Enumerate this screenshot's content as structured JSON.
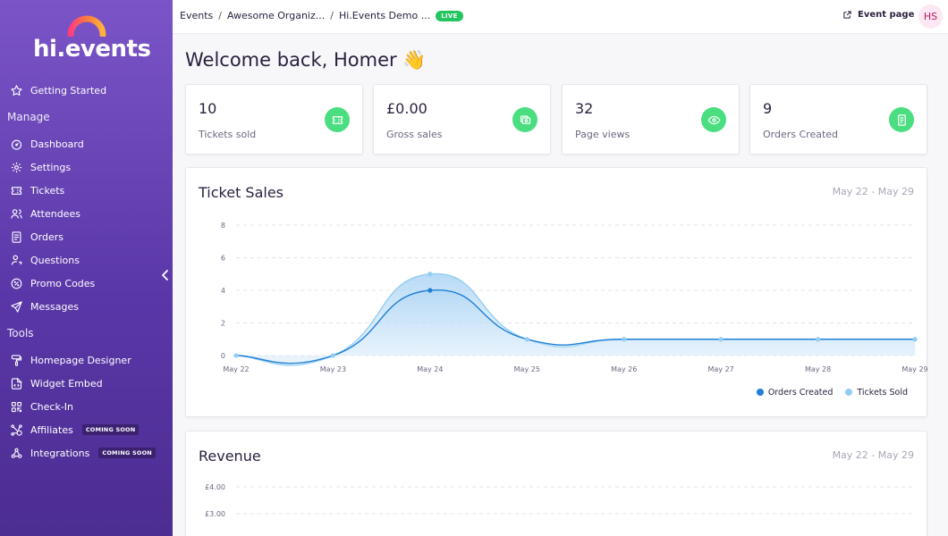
{
  "brand": {
    "name": "hi.events",
    "accent": "#7b55c7"
  },
  "topbar": {
    "breadcrumbs": [
      "Events",
      "Awesome Organiz...",
      "Hi.Events Demo ..."
    ],
    "status_badge": "LIVE",
    "event_page_label": "Event page",
    "avatar_initials": "HS"
  },
  "sidebar": {
    "top_item": {
      "label": "Getting Started",
      "icon": "star-icon"
    },
    "manage_title": "Manage",
    "manage_items": [
      {
        "label": "Dashboard",
        "icon": "dashboard-icon"
      },
      {
        "label": "Settings",
        "icon": "gear-icon"
      },
      {
        "label": "Tickets",
        "icon": "ticket-icon"
      },
      {
        "label": "Attendees",
        "icon": "users-icon"
      },
      {
        "label": "Orders",
        "icon": "receipt-icon"
      },
      {
        "label": "Questions",
        "icon": "user-question-icon"
      },
      {
        "label": "Promo Codes",
        "icon": "discount-icon"
      },
      {
        "label": "Messages",
        "icon": "send-icon"
      }
    ],
    "tools_title": "Tools",
    "tools_items": [
      {
        "label": "Homepage Designer",
        "icon": "paint-icon"
      },
      {
        "label": "Widget Embed",
        "icon": "embed-icon"
      },
      {
        "label": "Check-In",
        "icon": "qr-icon"
      },
      {
        "label": "Affiliates",
        "icon": "affiliate-icon",
        "badge": "COMING SOON"
      },
      {
        "label": "Integrations",
        "icon": "webhook-icon",
        "badge": "COMING SOON"
      }
    ]
  },
  "main": {
    "welcome": "Welcome back, Homer 👋",
    "stats": [
      {
        "value": "10",
        "label": "Tickets sold",
        "icon": "ticket-icon"
      },
      {
        "value": "£0.00",
        "label": "Gross sales",
        "icon": "cash-icon"
      },
      {
        "value": "32",
        "label": "Page views",
        "icon": "eye-icon"
      },
      {
        "value": "9",
        "label": "Orders Created",
        "icon": "receipt-icon"
      }
    ],
    "ticket_sales_title": "Ticket Sales",
    "ticket_sales_range": "May 22 - May 29",
    "revenue_title": "Revenue",
    "revenue_range": "May 22 - May 29"
  },
  "chart_data": [
    {
      "type": "area",
      "title": "Ticket Sales",
      "x": [
        "May 22",
        "May 23",
        "May 24",
        "May 25",
        "May 26",
        "May 27",
        "May 28",
        "May 29"
      ],
      "ylim": [
        0,
        8
      ],
      "yticks": [
        "8",
        "6",
        "4",
        "2",
        "0"
      ],
      "grid": true,
      "legend_position": "bottom-right",
      "series": [
        {
          "name": "Orders Created",
          "values": [
            0,
            0,
            4,
            1,
            1,
            1,
            1,
            1
          ],
          "color": "#1e7fd6"
        },
        {
          "name": "Tickets Sold",
          "values": [
            0,
            0,
            5,
            1,
            1,
            1,
            1,
            1
          ],
          "color": "#93cdf3"
        }
      ]
    },
    {
      "type": "area",
      "title": "Revenue",
      "yticks": [
        "£4.00",
        "£3.00"
      ],
      "grid": true
    }
  ]
}
